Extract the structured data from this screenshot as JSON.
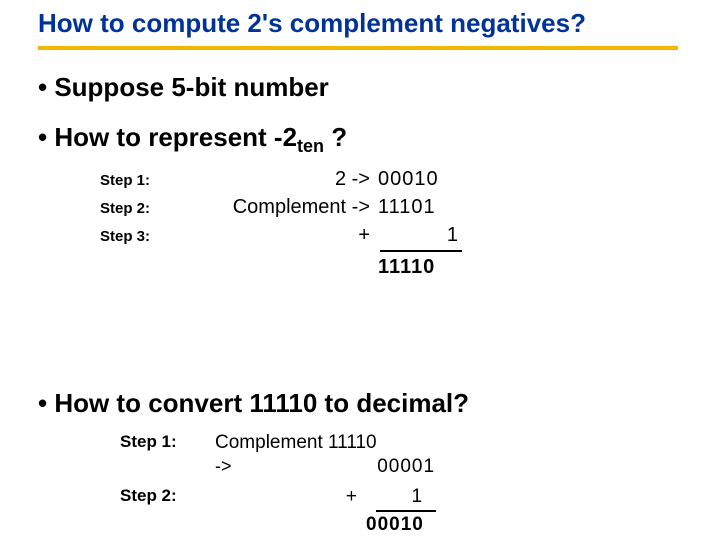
{
  "title": "How to compute 2's complement negatives?",
  "bullets": {
    "b1": "• Suppose 5-bit number",
    "b2_pre": "• How to represent -2",
    "b2_sub": "ten",
    "b2_post": " ?",
    "b3": "• How to convert  11110 to decimal?"
  },
  "sectionA": {
    "step1": {
      "label": "Step 1:",
      "op": "2 ->",
      "val": "00010"
    },
    "step2": {
      "label": "Step 2:",
      "op": "Complement ->",
      "val": "11101"
    },
    "step3": {
      "label": "Step 3:",
      "op": "+",
      "val": "1"
    },
    "result": "11110"
  },
  "sectionB": {
    "step1": {
      "label": "Step 1:",
      "text": "Complement 11110",
      "arrow": "->",
      "val": "00001"
    },
    "step2": {
      "label": "Step 2:",
      "plus": "+",
      "val": "1"
    },
    "result": "00010"
  }
}
